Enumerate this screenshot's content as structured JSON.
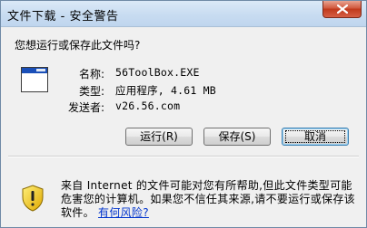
{
  "window": {
    "title": "文件下载 - 安全警告"
  },
  "question": "您想运行或保存此文件吗?",
  "file": {
    "name_label": "名称:",
    "name_value": "56ToolBox.EXE",
    "type_label": "类型:",
    "type_value": "应用程序, 4.61 MB",
    "from_label": "发送者:",
    "from_value": "v26.56.com"
  },
  "buttons": {
    "run": "运行(R)",
    "save": "保存(S)",
    "cancel": "取消"
  },
  "warning": {
    "text": "来自 Internet 的文件可能对您有所帮助,但此文件类型可能危害您的计算机。如果您不信任其来源,请不要运行或保存该软件。",
    "link": "有何风险?"
  },
  "icons": {
    "close": "close-icon",
    "file": "application-file-icon",
    "warning": "security-shield-icon"
  }
}
